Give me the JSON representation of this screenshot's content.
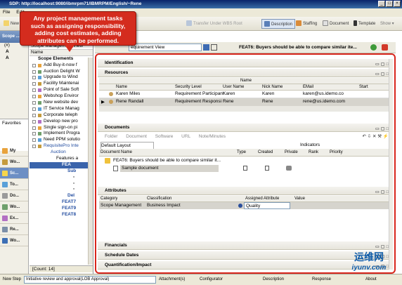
{
  "window": {
    "title": "SDP: http://localhost:9080/ibmrpm71/IBMRPM/English/~Rene",
    "controls": [
      "_",
      "□",
      "×"
    ]
  },
  "menu": [
    "File",
    "Edit"
  ],
  "toolbar": {
    "new_label": "New",
    "transfer_label": "Transfer Under WBS Root",
    "description_label": "Description",
    "staffing_label": "Staffing",
    "document_label": "Document",
    "template_label": "Template",
    "show_label": "Show ▾"
  },
  "callout": {
    "line1": "Any project management tasks",
    "line2": "such as assigning responsibility,",
    "line3": "adding  cost estimates, adding",
    "line4": "attributes can be performed."
  },
  "left": {
    "scope_label": "Scope ...",
    "scope_view": "Scope Management View",
    "name_header": "Name",
    "root": "Scope Elements",
    "items": [
      "Add Buy-it-now f",
      "Auction Delight W",
      "Upgrade to Wind",
      "Facility Maintenai",
      "Point of Sale Soft",
      "Webshop Enviror",
      "New website dev",
      "IT Service Manag",
      "Corporate teleph",
      "Develop new pro",
      "Single sign-on pi",
      "Implement Progra",
      "Need PPM solutio",
      "RequisitePro Inte"
    ],
    "sub": {
      "auction": "Auction",
      "features": "Features a",
      "fea": "FEA",
      "sub": "Sub",
      "del": "Del",
      "feat7": "FEAT7",
      "feat9": "FEAT9",
      "feat8": "FEAT8"
    },
    "count": "[Count: 14]",
    "favorites": "Favorites"
  },
  "outer_left": {
    "hash": "(#)",
    "a1": "A",
    "a2": "A"
  },
  "nav": [
    "My",
    "Wo...",
    "Sc...",
    "To...",
    "Do...",
    "Wo...",
    "Ex...",
    "Re...",
    "Wo..."
  ],
  "right": {
    "view_select": "equirement View",
    "feat_title": "FEAT6: Buyers should be able to compare similar ite...",
    "identification": "Identification",
    "resources": "Resources",
    "res_name_group": "Name",
    "res_headers": {
      "name": "Name",
      "security": "Security Level",
      "user": "User Name",
      "nick": "Nick Name",
      "email": "EMail",
      "start": "Start"
    },
    "res_rows": [
      {
        "name": "Karen Miles",
        "security": "Requirement Participant",
        "user": "Karen",
        "nick": "Karen",
        "email": "karen@us.idemo.co"
      },
      {
        "name": "Rene Randall",
        "security": "Requirement Responsib",
        "user": "Rene",
        "nick": "Rene",
        "email": "rene@us.idemo.com"
      }
    ],
    "documents": "Documents",
    "doc_tabs": [
      "Folder",
      "Document",
      "Software",
      "URL",
      "Note/Minutes"
    ],
    "layout": "Default Layout",
    "indicators": "Indicators",
    "doc_name_hdr": "Document Name",
    "doc_filters": [
      "Type",
      "Created",
      "Private",
      "Rank",
      "Priority"
    ],
    "doc_parent": "FEAT6: Buyers should be able to compare similar it...",
    "doc_child": "Sample document",
    "attributes": "Attributes",
    "attr_headers": {
      "category": "Category",
      "classification": "Classification",
      "assigned": "Assigned Attribute",
      "value": "Value"
    },
    "attr_row": {
      "category": "Scope Management",
      "classification": "Business Impact",
      "assigned": "Quality"
    },
    "financials": "Financials",
    "schedule": "Schedule Dates",
    "quant": "Quantification/Impact"
  },
  "status": {
    "next_step": "New Step",
    "approval": "Initiative review and approval(LOB Approval)",
    "attachments": "Attachment(s)",
    "configurator": "Configurator",
    "description": "Description",
    "response": "Response",
    "about": "About"
  },
  "watermark": {
    "cn": "运维网",
    "url": "iyunv.com"
  }
}
